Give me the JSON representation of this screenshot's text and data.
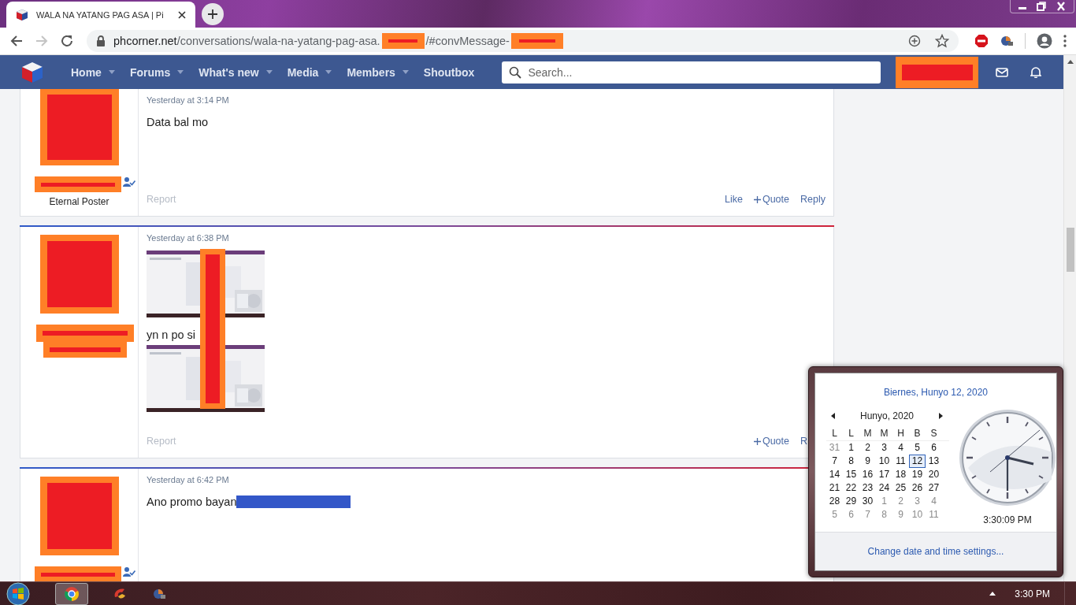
{
  "browser": {
    "tab_title": "WALA NA YATANG PAG ASA | Pi",
    "url_host": "phcorner.net",
    "url_path_1": "/conversations/wala-na-yatang-pag-asa.",
    "url_path_2": "/#convMessage-",
    "forward_enabled": false
  },
  "nav": {
    "items": [
      {
        "label": "Home",
        "has_menu": true
      },
      {
        "label": "Forums",
        "has_menu": true
      },
      {
        "label": "What's new",
        "has_menu": true
      },
      {
        "label": "Media",
        "has_menu": true
      },
      {
        "label": "Members",
        "has_menu": true
      },
      {
        "label": "Shoutbox",
        "has_menu": false
      }
    ],
    "search": {
      "placeholder": "Search..."
    }
  },
  "messages": [
    {
      "time": "Yesterday at 3:14 PM",
      "username_redaction": {
        "kind": "single"
      },
      "verified": true,
      "user_title": "Eternal Poster",
      "content": [
        {
          "kind": "text",
          "text": "Data bal mo"
        }
      ],
      "report": "Report",
      "actions": [
        {
          "kind": "like",
          "label": "Like"
        },
        {
          "kind": "quote",
          "label": "Quote"
        },
        {
          "kind": "reply",
          "label": "Reply"
        }
      ]
    },
    {
      "time": "Yesterday at 6:38 PM",
      "username_redaction": {
        "kind": "double"
      },
      "verified": false,
      "redaction_bar": true,
      "content": [
        {
          "kind": "picture"
        },
        {
          "kind": "text",
          "text": "yn n po si"
        },
        {
          "kind": "picture"
        }
      ],
      "report": "Report",
      "actions": [
        {
          "kind": "quote",
          "label": "Quote"
        },
        {
          "kind": "reply",
          "label": "R"
        }
      ]
    },
    {
      "time": "Yesterday at 6:42 PM",
      "username_redaction": {
        "kind": "single"
      },
      "verified": true,
      "content": [
        {
          "kind": "text",
          "text": "Ano promo bayan",
          "redacted_tail": true
        }
      ]
    }
  ],
  "calendar": {
    "long_date": "Biernes, Hunyo 12, 2020",
    "month": "Hunyo, 2020",
    "weekdays": [
      "L",
      "L",
      "M",
      "M",
      "H",
      "B",
      "S"
    ],
    "days": [
      {
        "day": "31",
        "in_month": false,
        "selected": false
      },
      {
        "day": "1",
        "in_month": true,
        "selected": false
      },
      {
        "day": "2",
        "in_month": true,
        "selected": false
      },
      {
        "day": "3",
        "in_month": true,
        "selected": false
      },
      {
        "day": "4",
        "in_month": true,
        "selected": false
      },
      {
        "day": "5",
        "in_month": true,
        "selected": false
      },
      {
        "day": "6",
        "in_month": true,
        "selected": false
      },
      {
        "day": "7",
        "in_month": true,
        "selected": false
      },
      {
        "day": "8",
        "in_month": true,
        "selected": false
      },
      {
        "day": "9",
        "in_month": true,
        "selected": false
      },
      {
        "day": "10",
        "in_month": true,
        "selected": false
      },
      {
        "day": "11",
        "in_month": true,
        "selected": false
      },
      {
        "day": "12",
        "in_month": true,
        "selected": true
      },
      {
        "day": "13",
        "in_month": true,
        "selected": false
      },
      {
        "day": "14",
        "in_month": true,
        "selected": false
      },
      {
        "day": "15",
        "in_month": true,
        "selected": false
      },
      {
        "day": "16",
        "in_month": true,
        "selected": false
      },
      {
        "day": "17",
        "in_month": true,
        "selected": false
      },
      {
        "day": "18",
        "in_month": true,
        "selected": false
      },
      {
        "day": "19",
        "in_month": true,
        "selected": false
      },
      {
        "day": "20",
        "in_month": true,
        "selected": false
      },
      {
        "day": "21",
        "in_month": true,
        "selected": false
      },
      {
        "day": "22",
        "in_month": true,
        "selected": false
      },
      {
        "day": "23",
        "in_month": true,
        "selected": false
      },
      {
        "day": "24",
        "in_month": true,
        "selected": false
      },
      {
        "day": "25",
        "in_month": true,
        "selected": false
      },
      {
        "day": "26",
        "in_month": true,
        "selected": false
      },
      {
        "day": "27",
        "in_month": true,
        "selected": false
      },
      {
        "day": "28",
        "in_month": true,
        "selected": false
      },
      {
        "day": "29",
        "in_month": true,
        "selected": false
      },
      {
        "day": "30",
        "in_month": true,
        "selected": false
      },
      {
        "day": "1",
        "in_month": false,
        "selected": false
      },
      {
        "day": "2",
        "in_month": false,
        "selected": false
      },
      {
        "day": "3",
        "in_month": false,
        "selected": false
      },
      {
        "day": "4",
        "in_month": false,
        "selected": false
      },
      {
        "day": "5",
        "in_month": false,
        "selected": false
      },
      {
        "day": "6",
        "in_month": false,
        "selected": false
      },
      {
        "day": "7",
        "in_month": false,
        "selected": false
      },
      {
        "day": "8",
        "in_month": false,
        "selected": false
      },
      {
        "day": "9",
        "in_month": false,
        "selected": false
      },
      {
        "day": "10",
        "in_month": false,
        "selected": false
      },
      {
        "day": "11",
        "in_month": false,
        "selected": false
      }
    ],
    "time": "3:30:09 PM",
    "settings_link": "Change date and time settings..."
  },
  "taskbar": {
    "time": "3:30 PM"
  }
}
